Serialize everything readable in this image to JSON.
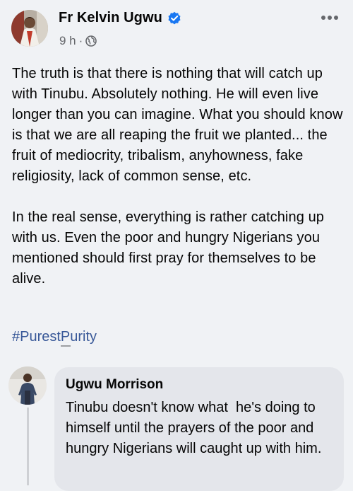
{
  "post": {
    "author": "Fr Kelvin Ugwu",
    "time": "9 h",
    "separator": "·",
    "paragraphs": [
      "The truth is that there is nothing that will catch up with Tinubu. Absolutely nothing. He will even live longer than you can imagine. What you should know is that we are all reaping the fruit we planted... the fruit of mediocrity, tribalism, anyhowness, fake religiosity, lack of common sense, etc.",
      "In the real sense, everything is rather catching up with us. Even the poor and hungry Nigerians you mentioned should first pray for themselves to be alive."
    ],
    "hashtag": "#PurestPurity"
  },
  "comment": {
    "author": "Ugwu Morrison",
    "text": "Tinubu doesn't know what  he's doing to himself until the prayers of the poor and hungry Nigerians will caught up with him."
  },
  "icons": {
    "verified": "verified-badge-icon",
    "globe": "globe-icon",
    "more": "more-options-icon"
  },
  "colors": {
    "verified_blue": "#1877f2",
    "hashtag_blue": "#385898",
    "secondary_text": "#65676b",
    "bubble_bg": "#e4e6eb",
    "page_bg": "#f0f2f5"
  }
}
